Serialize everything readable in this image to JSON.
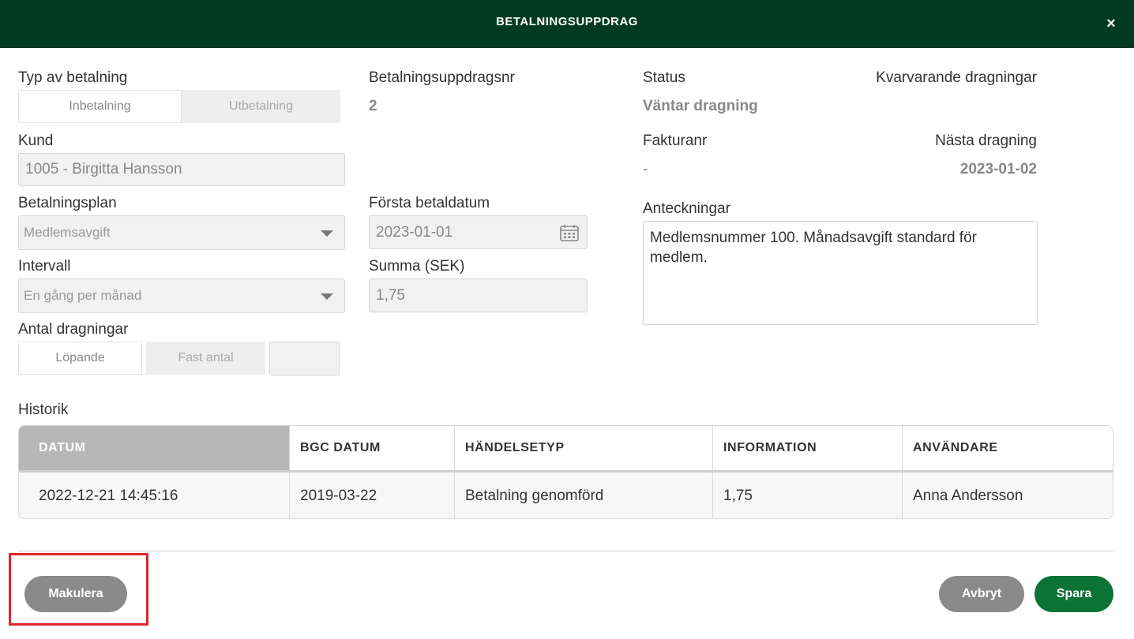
{
  "dialog": {
    "title": "BETALNINGSUPPDRAG",
    "close_icon": "×"
  },
  "payment_type": {
    "label": "Typ av betalning",
    "options": [
      "Inbetalning",
      "Utbetalning"
    ],
    "selected": "Inbetalning"
  },
  "order_number": {
    "label": "Betalningsuppdragsnr",
    "value": "2"
  },
  "status": {
    "label": "Status",
    "value": "Väntar dragning"
  },
  "remaining": {
    "label": "Kvarvarande dragningar"
  },
  "customer": {
    "label": "Kund",
    "value": "1005 - Birgitta Hansson"
  },
  "invoice": {
    "label": "Fakturanr",
    "value": "-"
  },
  "next_draw": {
    "label": "Nästa dragning",
    "value": "2023-01-02"
  },
  "plan": {
    "label": "Betalningsplan",
    "value": "Medlemsavgift"
  },
  "first_date": {
    "label": "Första betaldatum",
    "value": "2023-01-01"
  },
  "notes": {
    "label": "Anteckningar",
    "value": "Medlemsnummer 100. Månadsavgift standard för medlem."
  },
  "interval": {
    "label": "Intervall",
    "value": "En gång per månad"
  },
  "amount": {
    "label": "Summa (SEK)",
    "value": "1,75"
  },
  "draw_count": {
    "label": "Antal dragningar",
    "options": [
      "Löpande",
      "Fast antal"
    ],
    "selected": "Löpande",
    "count_value": ""
  },
  "history": {
    "label": "Historik",
    "columns": [
      "DATUM",
      "BGC DATUM",
      "HÄNDELSETYP",
      "INFORMATION",
      "ANVÄNDARE"
    ],
    "rows": [
      [
        "2022-12-21 14:45:16",
        "2019-03-22",
        "Betalning genomförd",
        "1,75",
        "Anna Andersson"
      ]
    ]
  },
  "footer": {
    "void_label": "Makulera",
    "cancel_label": "Avbryt",
    "save_label": "Spara"
  },
  "colors": {
    "header": "#013a22",
    "save": "#0b7335",
    "grey_button": "#8a8a8a",
    "highlight": "#e0252c"
  }
}
